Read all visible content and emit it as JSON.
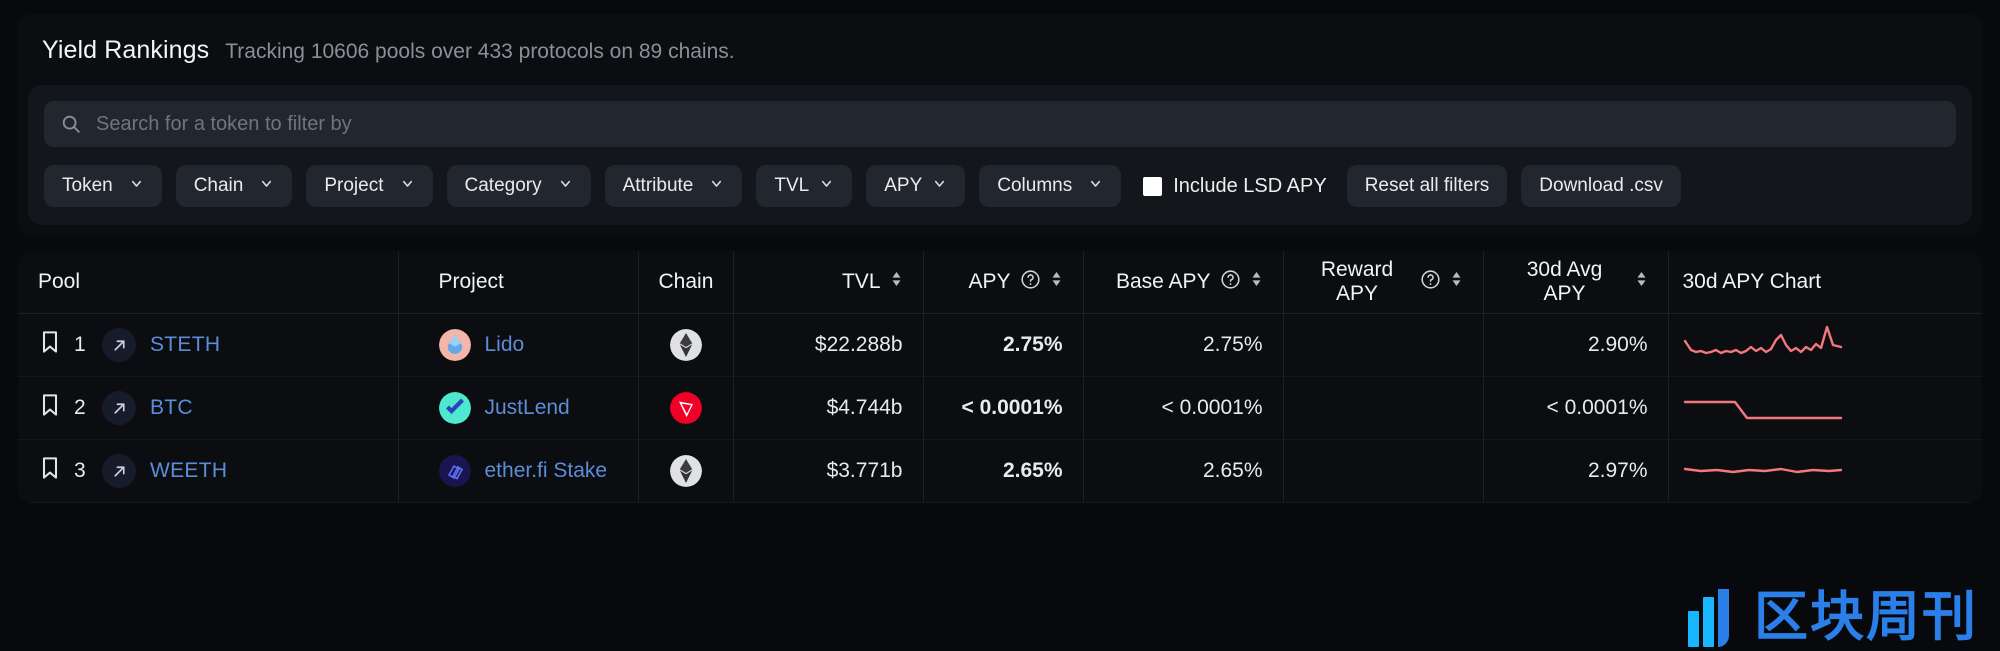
{
  "header": {
    "title": "Yield Rankings",
    "subtitle": "Tracking 10606 pools over 433 protocols on 89 chains."
  },
  "search": {
    "placeholder": "Search for a token to filter by",
    "value": "",
    "icon": "search-icon"
  },
  "filters": {
    "dropdowns": [
      {
        "label": "Token"
      },
      {
        "label": "Chain"
      },
      {
        "label": "Project"
      },
      {
        "label": "Category"
      },
      {
        "label": "Attribute"
      },
      {
        "label": "TVL"
      },
      {
        "label": "APY"
      },
      {
        "label": "Columns"
      }
    ],
    "checkbox": {
      "label": "Include LSD APY",
      "checked": true
    },
    "reset_label": "Reset all filters",
    "download_label": "Download .csv"
  },
  "table": {
    "columns": [
      {
        "key": "pool",
        "label": "Pool",
        "align": "left",
        "help": false,
        "sort": false
      },
      {
        "key": "project",
        "label": "Project",
        "align": "left",
        "help": false,
        "sort": false
      },
      {
        "key": "chain",
        "label": "Chain",
        "align": "left",
        "help": false,
        "sort": false
      },
      {
        "key": "tvl",
        "label": "TVL",
        "align": "right",
        "help": false,
        "sort": true
      },
      {
        "key": "apy",
        "label": "APY",
        "align": "right",
        "help": true,
        "sort": true
      },
      {
        "key": "base_apy",
        "label": "Base APY",
        "align": "right",
        "help": true,
        "sort": true
      },
      {
        "key": "reward",
        "label": "Reward APY",
        "align": "right",
        "help": true,
        "sort": true
      },
      {
        "key": "avg30d",
        "label": "30d Avg APY",
        "align": "right",
        "help": false,
        "sort": true
      },
      {
        "key": "chart",
        "label": "30d APY Chart",
        "align": "left",
        "help": false,
        "sort": false
      }
    ],
    "rows": [
      {
        "rank": "1",
        "pool": "STETH",
        "project": "Lido",
        "project_logo": "lido-logo",
        "chain": "Ethereum",
        "chain_logo": "ethereum-logo",
        "tvl": "$22.288b",
        "apy": "2.75%",
        "base_apy": "2.75%",
        "reward_apy": "",
        "avg_30d": "2.90%",
        "chart_color": "#f4777f"
      },
      {
        "rank": "2",
        "pool": "BTC",
        "project": "JustLend",
        "project_logo": "justlend-logo",
        "chain": "Tron",
        "chain_logo": "tron-logo",
        "tvl": "$4.744b",
        "apy": "< 0.0001%",
        "base_apy": "< 0.0001%",
        "reward_apy": "",
        "avg_30d": "< 0.0001%",
        "chart_color": "#f4777f"
      },
      {
        "rank": "3",
        "pool": "WEETH",
        "project": "ether.fi Stake",
        "project_logo": "etherfi-logo",
        "chain": "Ethereum",
        "chain_logo": "ethereum-logo",
        "tvl": "$3.771b",
        "apy": "2.65%",
        "base_apy": "2.65%",
        "reward_apy": "",
        "avg_30d": "2.97%",
        "chart_color": "#f4777f"
      }
    ]
  },
  "watermark": {
    "text": "区块周刊"
  },
  "colors": {
    "link": "#5b8dd9",
    "accent_red": "#f4777f",
    "panel": "#0b0d10",
    "control": "#22262e"
  },
  "chart_data": [
    {
      "type": "line",
      "title": "30d APY Chart",
      "series": [
        {
          "name": "STETH",
          "values": [
            3.05,
            2.78,
            2.72,
            2.74,
            2.7,
            2.73,
            2.76,
            2.71,
            2.74,
            2.72,
            2.76,
            2.7,
            2.75,
            2.8,
            2.74,
            2.78,
            2.72,
            2.76,
            2.86,
            2.95,
            2.8,
            2.74,
            2.77,
            2.72,
            2.79,
            2.75,
            2.82,
            2.78,
            3.55,
            2.86
          ]
        }
      ],
      "ylim": [
        2.6,
        3.6
      ],
      "grid": false,
      "legend": false
    },
    {
      "type": "line",
      "title": "30d APY Chart",
      "series": [
        {
          "name": "BTC",
          "values": [
            0.92,
            0.92,
            0.92,
            0.92,
            0.92,
            0.92,
            0.92,
            0.92,
            0.92,
            0.92,
            0.7,
            0.42,
            0.4,
            0.4,
            0.4,
            0.4,
            0.4,
            0.4,
            0.4,
            0.4,
            0.4,
            0.4,
            0.4,
            0.4,
            0.4,
            0.4,
            0.4,
            0.4,
            0.4,
            0.4
          ]
        }
      ],
      "ylim": [
        0.3,
        1.0
      ],
      "grid": false,
      "legend": false
    },
    {
      "type": "line",
      "title": "30d APY Chart",
      "series": [
        {
          "name": "WEETH",
          "values": [
            2.97,
            2.95,
            2.96,
            2.94,
            2.97,
            2.95,
            2.96,
            2.94,
            2.95,
            2.97,
            2.94,
            2.96,
            2.95,
            2.93,
            2.96,
            2.94,
            2.95,
            2.96,
            2.94,
            2.95,
            2.93,
            2.96,
            2.94,
            2.95,
            2.93,
            2.96,
            2.94,
            2.95,
            2.96,
            2.94
          ]
        }
      ],
      "ylim": [
        2.9,
        3.0
      ],
      "grid": false,
      "legend": false
    }
  ]
}
